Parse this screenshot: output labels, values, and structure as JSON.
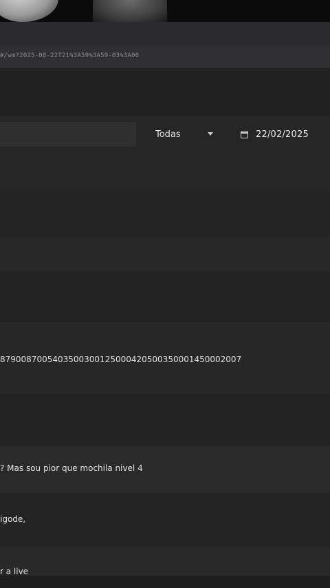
{
  "browser": {
    "url": "#/wm?2025-08-22T21%3A59%3A59-03%3A00"
  },
  "filters": {
    "category_value": "Todas",
    "date_value": "22/02/2025"
  },
  "messages": [
    {
      "text": "8790087005403500300125000420500350001450002007"
    },
    {
      "text": "? Mas sou pior que mochila nivel 4"
    },
    {
      "text": "igode,"
    },
    {
      "text": "r a live"
    }
  ],
  "icons": {
    "select": "chevron-down-icon",
    "date": "calendar-icon",
    "pointer": "mouse-cursor-icon"
  },
  "colors": {
    "background": "#242424",
    "row_alt": "#2a2a2a",
    "text": "#e2e2e2"
  }
}
